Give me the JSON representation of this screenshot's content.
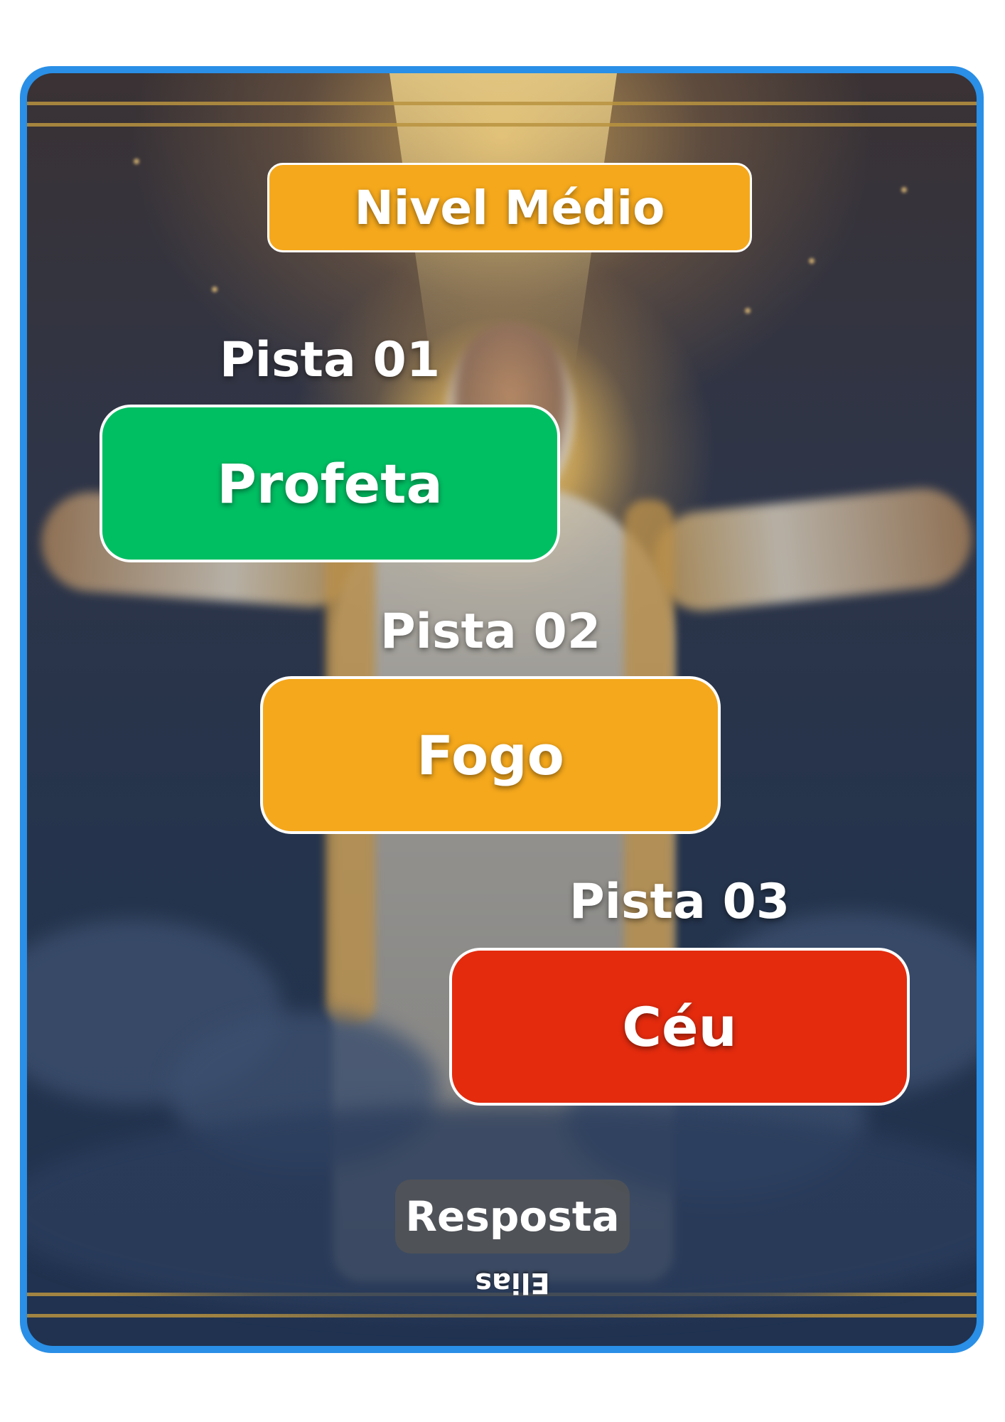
{
  "level": {
    "label": "Nivel Médio"
  },
  "clues": [
    {
      "title": "Pista 01",
      "value": "Profeta",
      "color": "#00bf63"
    },
    {
      "title": "Pista 02",
      "value": "Fogo",
      "color": "#f5a81c"
    },
    {
      "title": "Pista 03",
      "value": "Céu",
      "color": "#e42b0e"
    }
  ],
  "answer": {
    "label": "Resposta",
    "value": "Elias",
    "upside_down": true
  },
  "colors": {
    "frame_border": "#2a8fe6",
    "level_badge": "#f5a81c"
  }
}
